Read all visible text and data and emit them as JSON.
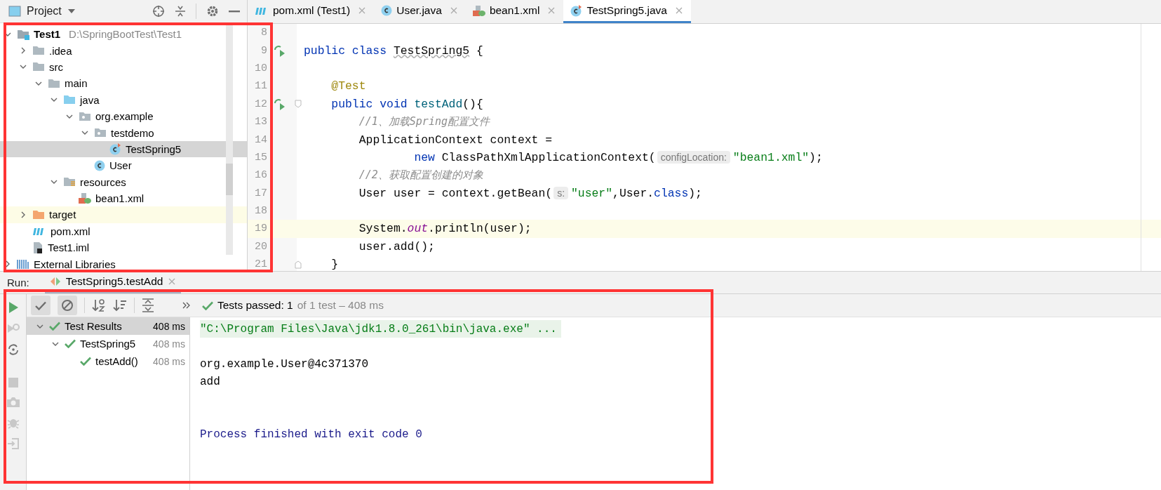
{
  "project_panel": {
    "title": "Project",
    "tree": [
      {
        "label": "Test1",
        "path": "D:\\SpringBootTest\\Test1",
        "kind": "module",
        "expanded": true,
        "selected": false,
        "highlighted": false,
        "children": [
          {
            "label": ".idea",
            "kind": "folder",
            "expanded": false,
            "selected": false,
            "highlighted": false
          },
          {
            "label": "src",
            "kind": "folder",
            "expanded": true,
            "selected": false,
            "highlighted": false,
            "children": [
              {
                "label": "main",
                "kind": "folder",
                "expanded": true,
                "selected": false,
                "highlighted": false,
                "children": [
                  {
                    "label": "java",
                    "kind": "source",
                    "expanded": true,
                    "selected": false,
                    "highlighted": false,
                    "children": [
                      {
                        "label": "org.example",
                        "kind": "package",
                        "expanded": true,
                        "selected": false,
                        "highlighted": false,
                        "children": [
                          {
                            "label": "testdemo",
                            "kind": "package",
                            "expanded": true,
                            "selected": false,
                            "highlighted": false,
                            "children": [
                              {
                                "label": "TestSpring5",
                                "kind": "testclass",
                                "selected": true,
                                "highlighted": false
                              }
                            ]
                          },
                          {
                            "label": "User",
                            "kind": "class",
                            "selected": false,
                            "highlighted": false
                          }
                        ]
                      }
                    ]
                  },
                  {
                    "label": "resources",
                    "kind": "resources",
                    "expanded": true,
                    "selected": false,
                    "highlighted": false,
                    "children": [
                      {
                        "label": "bean1.xml",
                        "kind": "xml",
                        "selected": false,
                        "highlighted": false
                      }
                    ]
                  }
                ]
              }
            ]
          },
          {
            "label": "target",
            "kind": "excluded",
            "expanded": false,
            "selected": false,
            "highlighted": true
          },
          {
            "label": "pom.xml",
            "kind": "maven",
            "selected": false,
            "highlighted": false
          },
          {
            "label": "Test1.iml",
            "kind": "iml",
            "selected": false,
            "highlighted": false
          }
        ]
      },
      {
        "label": "External Libraries",
        "kind": "libraries",
        "expanded": false,
        "selected": false,
        "highlighted": false
      }
    ]
  },
  "editor": {
    "tabs": [
      {
        "label": "pom.xml (Test1)",
        "kind": "maven",
        "selected": false
      },
      {
        "label": "User.java",
        "kind": "class",
        "selected": false
      },
      {
        "label": "bean1.xml",
        "kind": "xml",
        "selected": false
      },
      {
        "label": "TestSpring5.java",
        "kind": "testclass",
        "selected": true
      }
    ],
    "lines": [
      {
        "number": "8",
        "current": false
      },
      {
        "number": "9",
        "current": false,
        "run": true,
        "tokens": [
          {
            "kind": "keyword",
            "text": "public class "
          },
          {
            "kind": "warning",
            "text": "TestSpring5"
          },
          {
            "kind": "plain",
            "text": " {"
          }
        ]
      },
      {
        "number": "10",
        "current": false
      },
      {
        "number": "11",
        "current": false,
        "tokens": [
          {
            "kind": "annotation",
            "text": "    @Test"
          }
        ]
      },
      {
        "number": "12",
        "current": false,
        "run": true,
        "fold_start": true,
        "tokens": [
          {
            "kind": "keyword",
            "text": "    public void "
          },
          {
            "kind": "method",
            "text": "testAdd"
          },
          {
            "kind": "plain",
            "text": "(){"
          }
        ]
      },
      {
        "number": "13",
        "current": false,
        "tokens": [
          {
            "kind": "comment",
            "text": "        //1、加载Spring配置文件"
          }
        ]
      },
      {
        "number": "14",
        "current": false,
        "tokens": [
          {
            "kind": "plain",
            "text": "        ApplicationContext context ="
          }
        ]
      },
      {
        "number": "15",
        "current": false,
        "tokens": [
          {
            "kind": "keyword",
            "text": "                new"
          },
          {
            "kind": "plain",
            "text": " ClassPathXmlApplicationContext("
          },
          {
            "kind": "hint",
            "text": "configLocation:"
          },
          {
            "kind": "string",
            "text": "\"bean1.xml\""
          },
          {
            "kind": "plain",
            "text": ");"
          }
        ]
      },
      {
        "number": "16",
        "current": false,
        "tokens": [
          {
            "kind": "comment",
            "text": "        //2、获取配置创建的对象"
          }
        ]
      },
      {
        "number": "17",
        "current": false,
        "tokens": [
          {
            "kind": "plain",
            "text": "        User user = context.getBean("
          },
          {
            "kind": "hint",
            "text": "s:"
          },
          {
            "kind": "string",
            "text": "\"user\""
          },
          {
            "kind": "plain",
            "text": ",User."
          },
          {
            "kind": "keyword",
            "text": "class"
          },
          {
            "kind": "plain",
            "text": ");"
          }
        ]
      },
      {
        "number": "18",
        "current": false
      },
      {
        "number": "19",
        "current": true,
        "tokens": [
          {
            "kind": "plain",
            "text": "        System."
          },
          {
            "kind": "field",
            "text": "out"
          },
          {
            "kind": "plain",
            "text": ".println(user);"
          }
        ]
      },
      {
        "number": "20",
        "current": false,
        "tokens": [
          {
            "kind": "plain",
            "text": "        user.add();"
          }
        ]
      },
      {
        "number": "21",
        "current": false,
        "fold_end": true,
        "tokens": [
          {
            "kind": "plain",
            "text": "    }"
          }
        ]
      }
    ]
  },
  "run_panel": {
    "label": "Run:",
    "tab": "TestSpring5.testAdd",
    "status": {
      "label": "Tests passed: 1",
      "detail": "of 1 test – 408 ms"
    },
    "results": [
      {
        "label": "Test Results",
        "time": "408 ms",
        "passed": true,
        "selected": true,
        "expanded": true,
        "children": [
          {
            "label": "TestSpring5",
            "time": "408 ms",
            "passed": true,
            "selected": false,
            "expanded": true,
            "children": [
              {
                "label": "testAdd()",
                "time": "408 ms",
                "passed": true,
                "selected": false
              }
            ]
          }
        ]
      }
    ],
    "console": [
      {
        "kind": "command",
        "text": "\"C:\\Program Files\\Java\\jdk1.8.0_261\\bin\\java.exe\" ..."
      },
      {
        "kind": "output",
        "text": "org.example.User@4c371370"
      },
      {
        "kind": "output",
        "text": "add"
      },
      {
        "kind": "exit",
        "text": "Process finished with exit code 0"
      }
    ]
  }
}
